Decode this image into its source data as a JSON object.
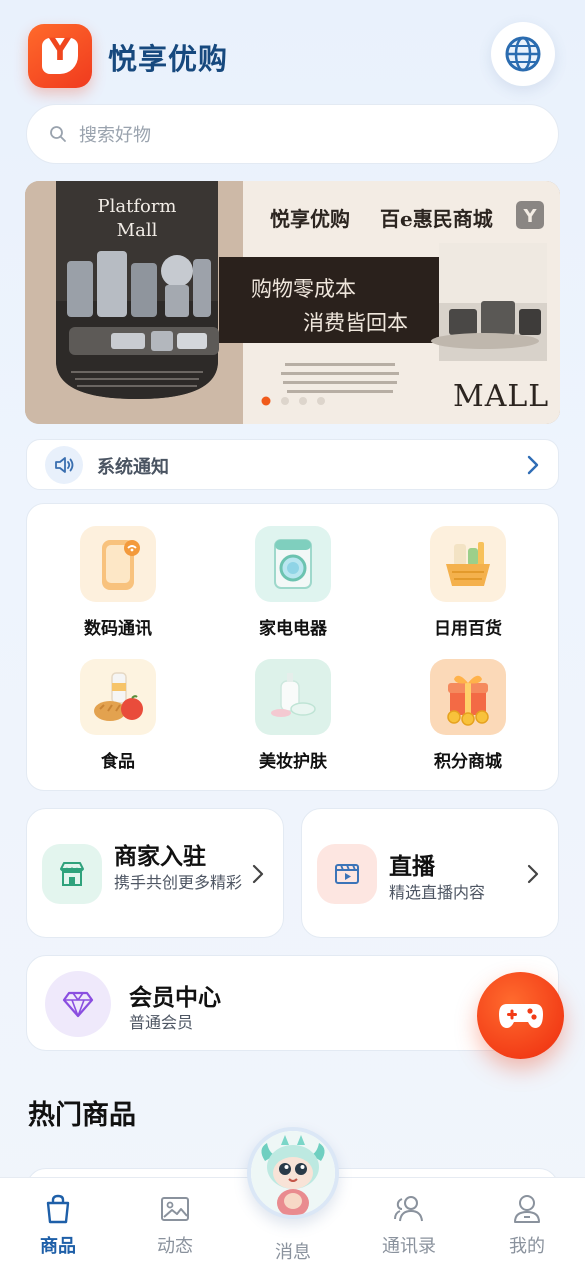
{
  "app": {
    "title": "悦享优购",
    "logo_letter": "Y"
  },
  "header": {
    "language_icon": "globe-icon"
  },
  "search": {
    "placeholder": "搜索好物"
  },
  "banner": {
    "left_title_line1": "Platform",
    "left_title_line2": "Mall",
    "brand": "悦享优购",
    "slogan_right": "百e惠民商城",
    "slogan1": "购物零成本",
    "slogan2": "消费皆回本",
    "mall": "MALL",
    "slides_total": 4,
    "slide_active_index": 1,
    "accent_color": "#f05a1a"
  },
  "notice": {
    "label": "系统通知"
  },
  "categories": [
    {
      "label": "数码通讯",
      "icon": "phone-icon"
    },
    {
      "label": "家电电器",
      "icon": "washing-machine-icon"
    },
    {
      "label": "日用百货",
      "icon": "basket-icon"
    },
    {
      "label": "食品",
      "icon": "food-icon"
    },
    {
      "label": "美妆护肤",
      "icon": "cosmetics-icon"
    },
    {
      "label": "积分商城",
      "icon": "gift-icon"
    }
  ],
  "cards": {
    "merchant": {
      "title": "商家入驻",
      "subtitle": "携手共创更多精彩"
    },
    "live": {
      "title": "直播",
      "subtitle": "精选直播内容"
    },
    "member": {
      "title": "会员中心",
      "subtitle": "普通会员"
    }
  },
  "hot": {
    "title": "热门商品"
  },
  "tabbar": {
    "items": [
      {
        "label": "商品",
        "active": true
      },
      {
        "label": "动态",
        "active": false
      },
      {
        "label": "消息",
        "active": false
      },
      {
        "label": "通讯录",
        "active": false
      },
      {
        "label": "我的",
        "active": false
      }
    ]
  },
  "colors": {
    "brand": "#17497e",
    "primary": "#1e5fa8",
    "accent": "#f0461e"
  }
}
